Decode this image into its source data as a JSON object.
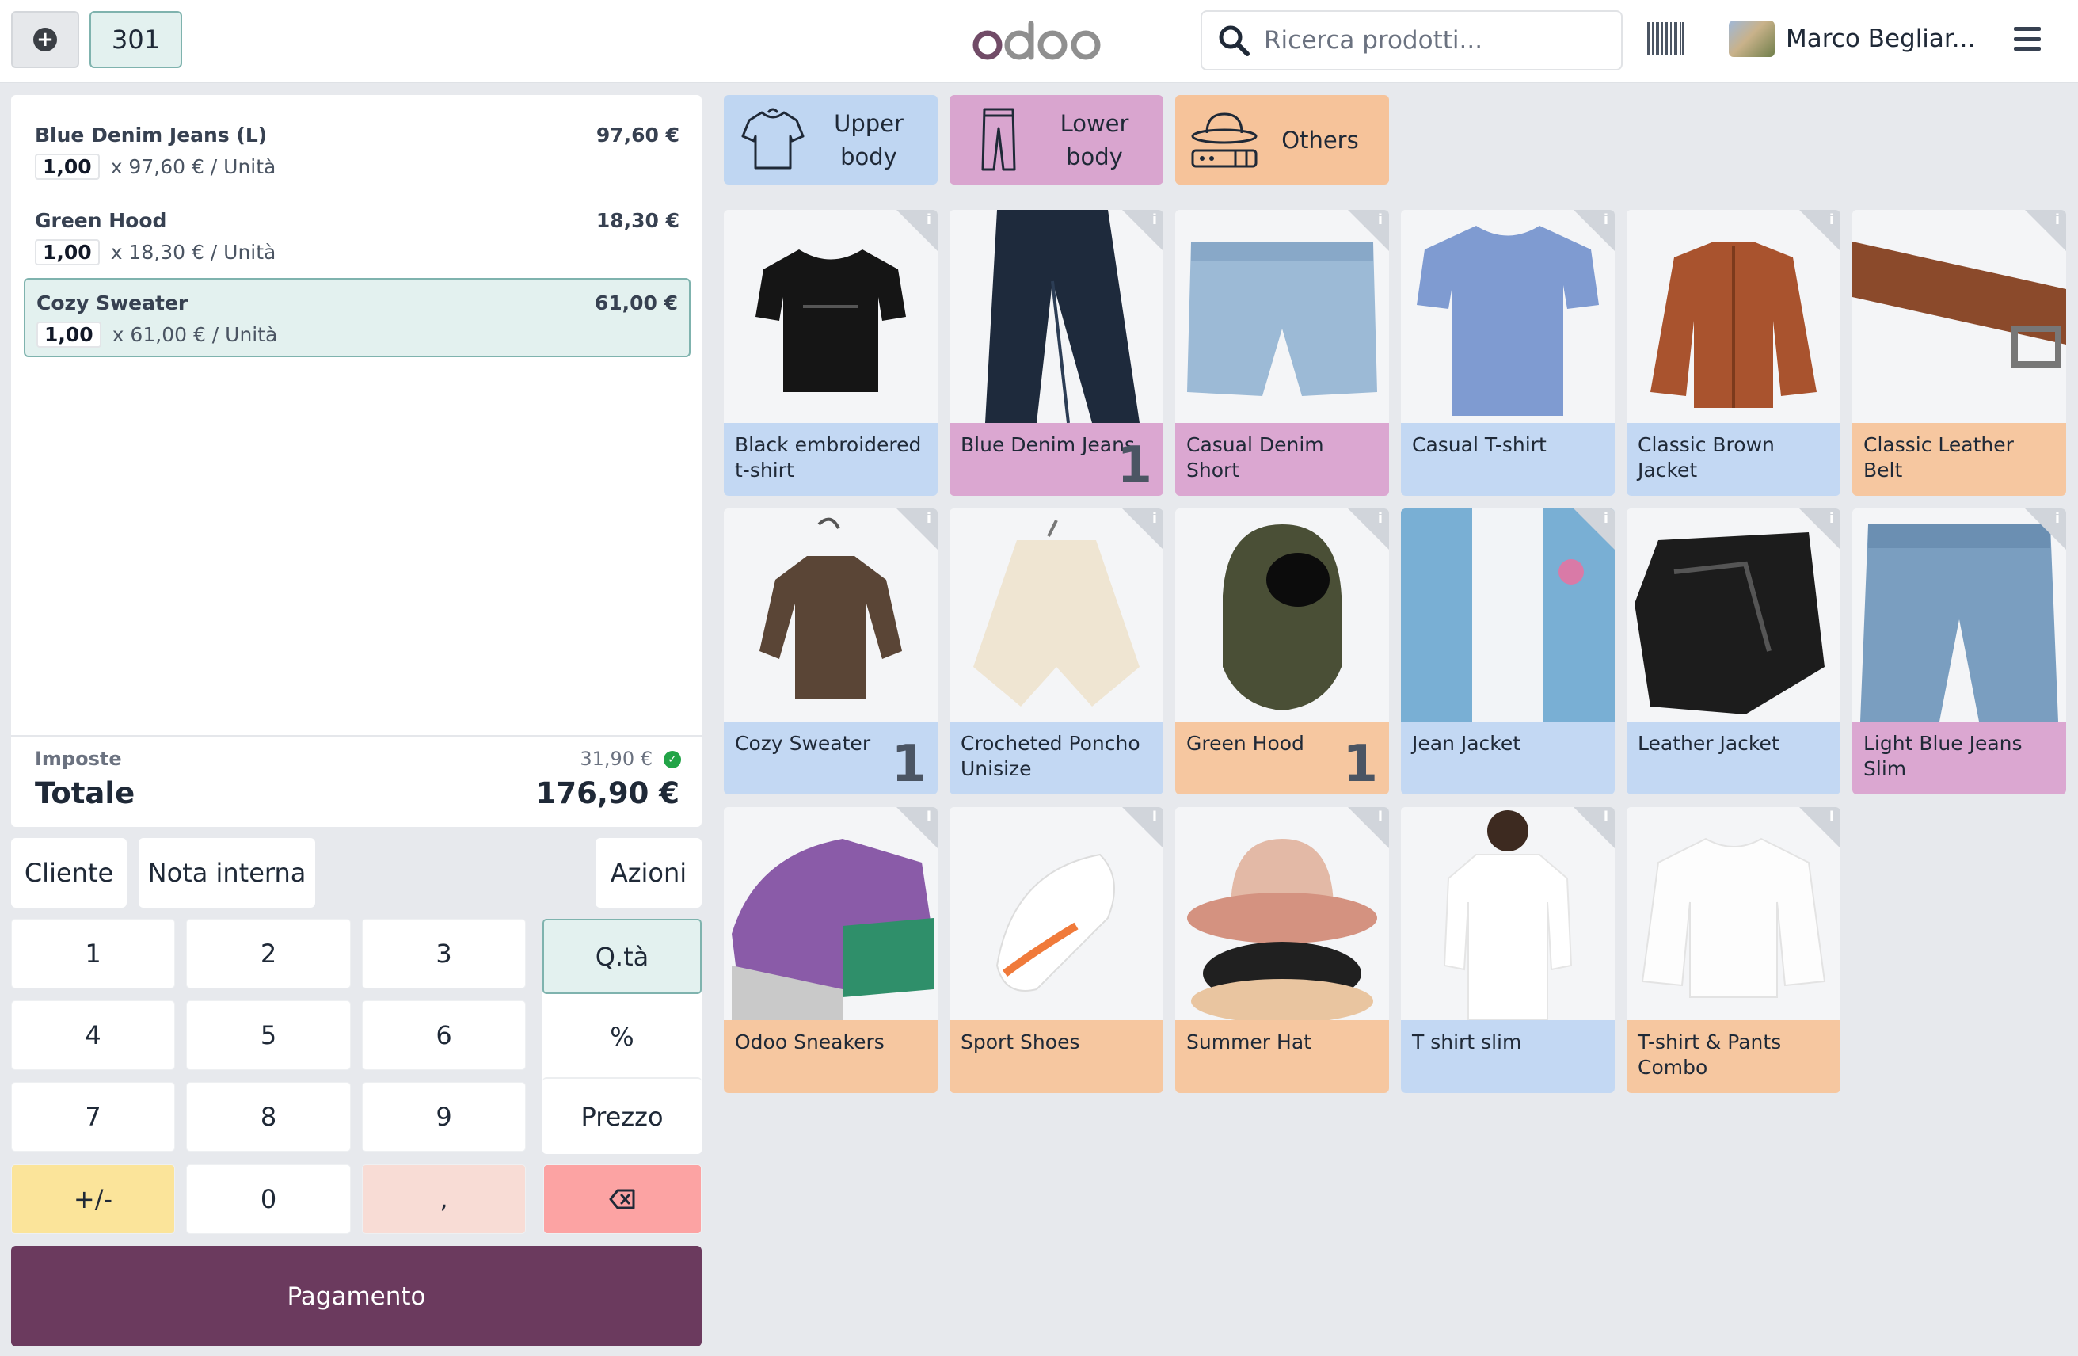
{
  "topbar": {
    "order_number": "301",
    "logo_text": "odoo",
    "search_placeholder": "Ricerca prodotti...",
    "user_name": "Marco Begliar..."
  },
  "order": {
    "lines": [
      {
        "name": "Blue Denim Jeans (L)",
        "price": "97,60 €",
        "qty": "1,00",
        "unit": "x 97,60 € / Unità"
      },
      {
        "name": "Green Hood",
        "price": "18,30 €",
        "qty": "1,00",
        "unit": "x 18,30 € / Unità"
      },
      {
        "name": "Cozy Sweater",
        "price": "61,00 €",
        "qty": "1,00",
        "unit": "x 61,00 € / Unità"
      }
    ],
    "tax_label": "Imposte",
    "tax_value": "31,90 €",
    "total_label": "Totale",
    "total_value": "176,90 €"
  },
  "controls": {
    "customer": "Cliente",
    "internal_note": "Nota interna",
    "actions": "Azioni"
  },
  "numpad": {
    "keys": [
      "1",
      "2",
      "3",
      "4",
      "5",
      "6",
      "7",
      "8",
      "9",
      "+/-",
      "0",
      ","
    ],
    "qty_mode": "Q.tà",
    "discount_mode": "%",
    "price_mode": "Prezzo",
    "payment": "Pagamento"
  },
  "categories": [
    {
      "label": "Upper body",
      "icon": "tshirt-icon"
    },
    {
      "label": "Lower body",
      "icon": "pants-icon"
    },
    {
      "label": "Others",
      "icon": "hat-belt-icon"
    }
  ],
  "products": [
    {
      "name": "Black embroidered t-shirt",
      "qty": ""
    },
    {
      "name": "Blue Denim Jeans",
      "qty": "1"
    },
    {
      "name": "Casual Denim Short",
      "qty": ""
    },
    {
      "name": "Casual T-shirt",
      "qty": ""
    },
    {
      "name": "Classic Brown Jacket",
      "qty": ""
    },
    {
      "name": "Classic Leather Belt",
      "qty": ""
    },
    {
      "name": "Cozy Sweater",
      "qty": "1"
    },
    {
      "name": "Crocheted Poncho Unisize",
      "qty": ""
    },
    {
      "name": "Green Hood",
      "qty": "1"
    },
    {
      "name": "Jean Jacket",
      "qty": ""
    },
    {
      "name": "Leather Jacket",
      "qty": ""
    },
    {
      "name": "Light Blue Jeans Slim",
      "qty": ""
    },
    {
      "name": "Odoo Sneakers",
      "qty": ""
    },
    {
      "name": "Sport Shoes",
      "qty": ""
    },
    {
      "name": "Summer Hat",
      "qty": ""
    },
    {
      "name": "T shirt slim",
      "qty": ""
    },
    {
      "name": "T-shirt & Pants Combo",
      "qty": ""
    }
  ],
  "colors": {
    "brand": "#6b3a5e",
    "upper_body": "#c3d8f3",
    "lower_body": "#dba7d1",
    "others": "#f6c7a0",
    "selected_line": "#e3f1ef"
  }
}
